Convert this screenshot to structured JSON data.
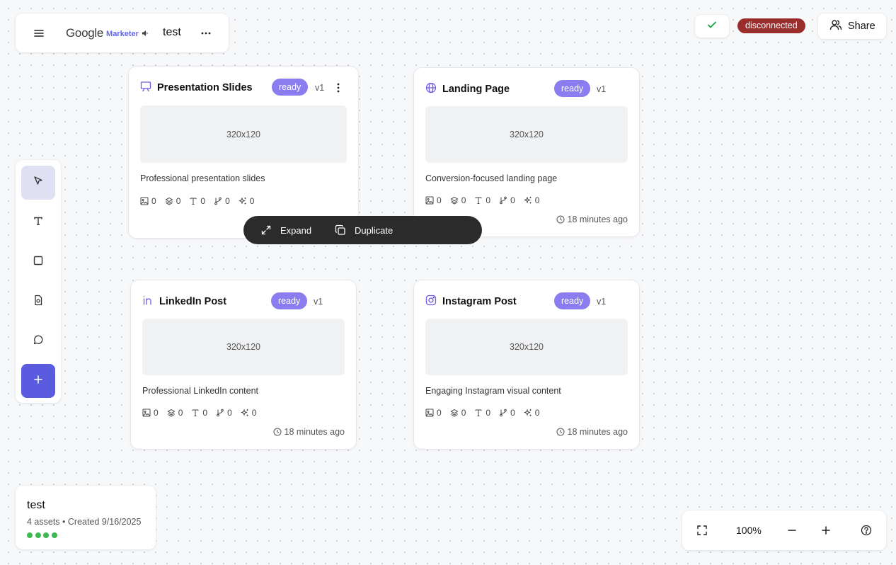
{
  "header": {
    "logo_text": "Google",
    "logo_sub": "Marketer",
    "project_name": "test"
  },
  "status": {
    "connection": "disconnected",
    "connection_color": "#9b2c2c",
    "check_color": "#16a34a",
    "share_label": "Share"
  },
  "toolbar": {
    "tools": [
      "select-tool",
      "text-tool",
      "rectangle-tool",
      "document-tool",
      "comment-tool",
      "add-tool"
    ],
    "accent": "#5b5be0"
  },
  "cards": [
    {
      "title": "Presentation Slides",
      "status": "ready",
      "version": "v1",
      "thumb": "320x120",
      "description": "Professional presentation slides",
      "stats": [
        "0",
        "0",
        "0",
        "0",
        "0"
      ],
      "time": ""
    },
    {
      "title": "Landing Page",
      "status": "ready",
      "version": "v1",
      "thumb": "320x120",
      "description": "Conversion-focused landing page",
      "stats": [
        "0",
        "0",
        "0",
        "0",
        "0"
      ],
      "time": "18 minutes ago"
    },
    {
      "title": "LinkedIn Post",
      "status": "ready",
      "version": "v1",
      "thumb": "320x120",
      "description": "Professional LinkedIn content",
      "stats": [
        "0",
        "0",
        "0",
        "0",
        "0"
      ],
      "time": "18 minutes ago"
    },
    {
      "title": "Instagram Post",
      "status": "ready",
      "version": "v1",
      "thumb": "320x120",
      "description": "Engaging Instagram visual content",
      "stats": [
        "0",
        "0",
        "0",
        "0",
        "0"
      ],
      "time": "18 minutes ago"
    }
  ],
  "action_bar": {
    "expand_label": "Expand",
    "duplicate_label": "Duplicate"
  },
  "project_info": {
    "name": "test",
    "meta": "4 assets • Created 9/16/2025",
    "dot_color": "#3fb950"
  },
  "zoom": {
    "level": "100%"
  }
}
